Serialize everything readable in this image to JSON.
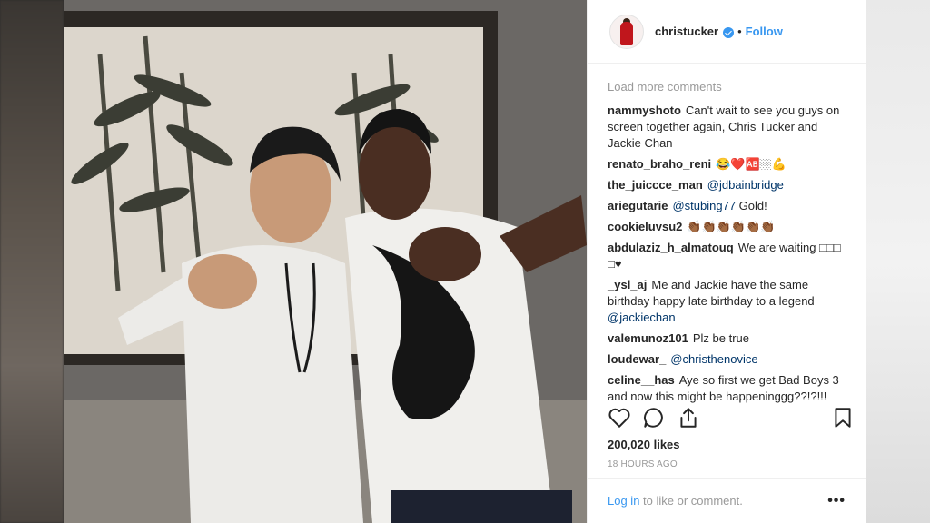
{
  "header": {
    "username": "christucker",
    "separator": "•",
    "follow_label": "Follow"
  },
  "comments": {
    "load_more": "Load more comments",
    "items": [
      {
        "user": "nammyshoto",
        "text": "Can't wait to see you guys on screen together again, Chris Tucker and Jackie Chan"
      },
      {
        "user": "renato_braho_reni",
        "text": "😂❤️🆎🏼💪"
      },
      {
        "user": "the_juiccce_man",
        "mention": "@jdbainbridge"
      },
      {
        "user": "ariegutarie",
        "mention": "@stubing77",
        "text": " Gold!"
      },
      {
        "user": "cookieluvsu2",
        "text": "👏🏾👏🏾👏🏾👏🏾👏🏾👏🏾"
      },
      {
        "user": "abdulaziz_h_almatouq",
        "text": "We are waiting □□□ □♥"
      },
      {
        "user": "_ysl_aj",
        "text": "Me and Jackie have the same birthday happy late birthday to a legend ",
        "mention": "@jackiechan"
      },
      {
        "user": "valemunoz101",
        "text": "Plz be true"
      },
      {
        "user": "loudewar_",
        "mention": "@christhenovice"
      },
      {
        "user": "celine__has",
        "text": "Aye so first we get Bad Boys 3 and now this might be happeninggg??!?!!!"
      }
    ]
  },
  "likes": "200,020 likes",
  "time": "18 HOURS AGO",
  "footer": {
    "login_link": "Log in",
    "login_rest": " to like or comment.",
    "more": "•••"
  },
  "icons": [
    "heart-icon",
    "comment-icon",
    "share-icon",
    "bookmark-icon",
    "verified-icon"
  ],
  "colors": {
    "link": "#3897f0",
    "mention": "#003569",
    "text": "#262626",
    "muted": "#999999"
  }
}
